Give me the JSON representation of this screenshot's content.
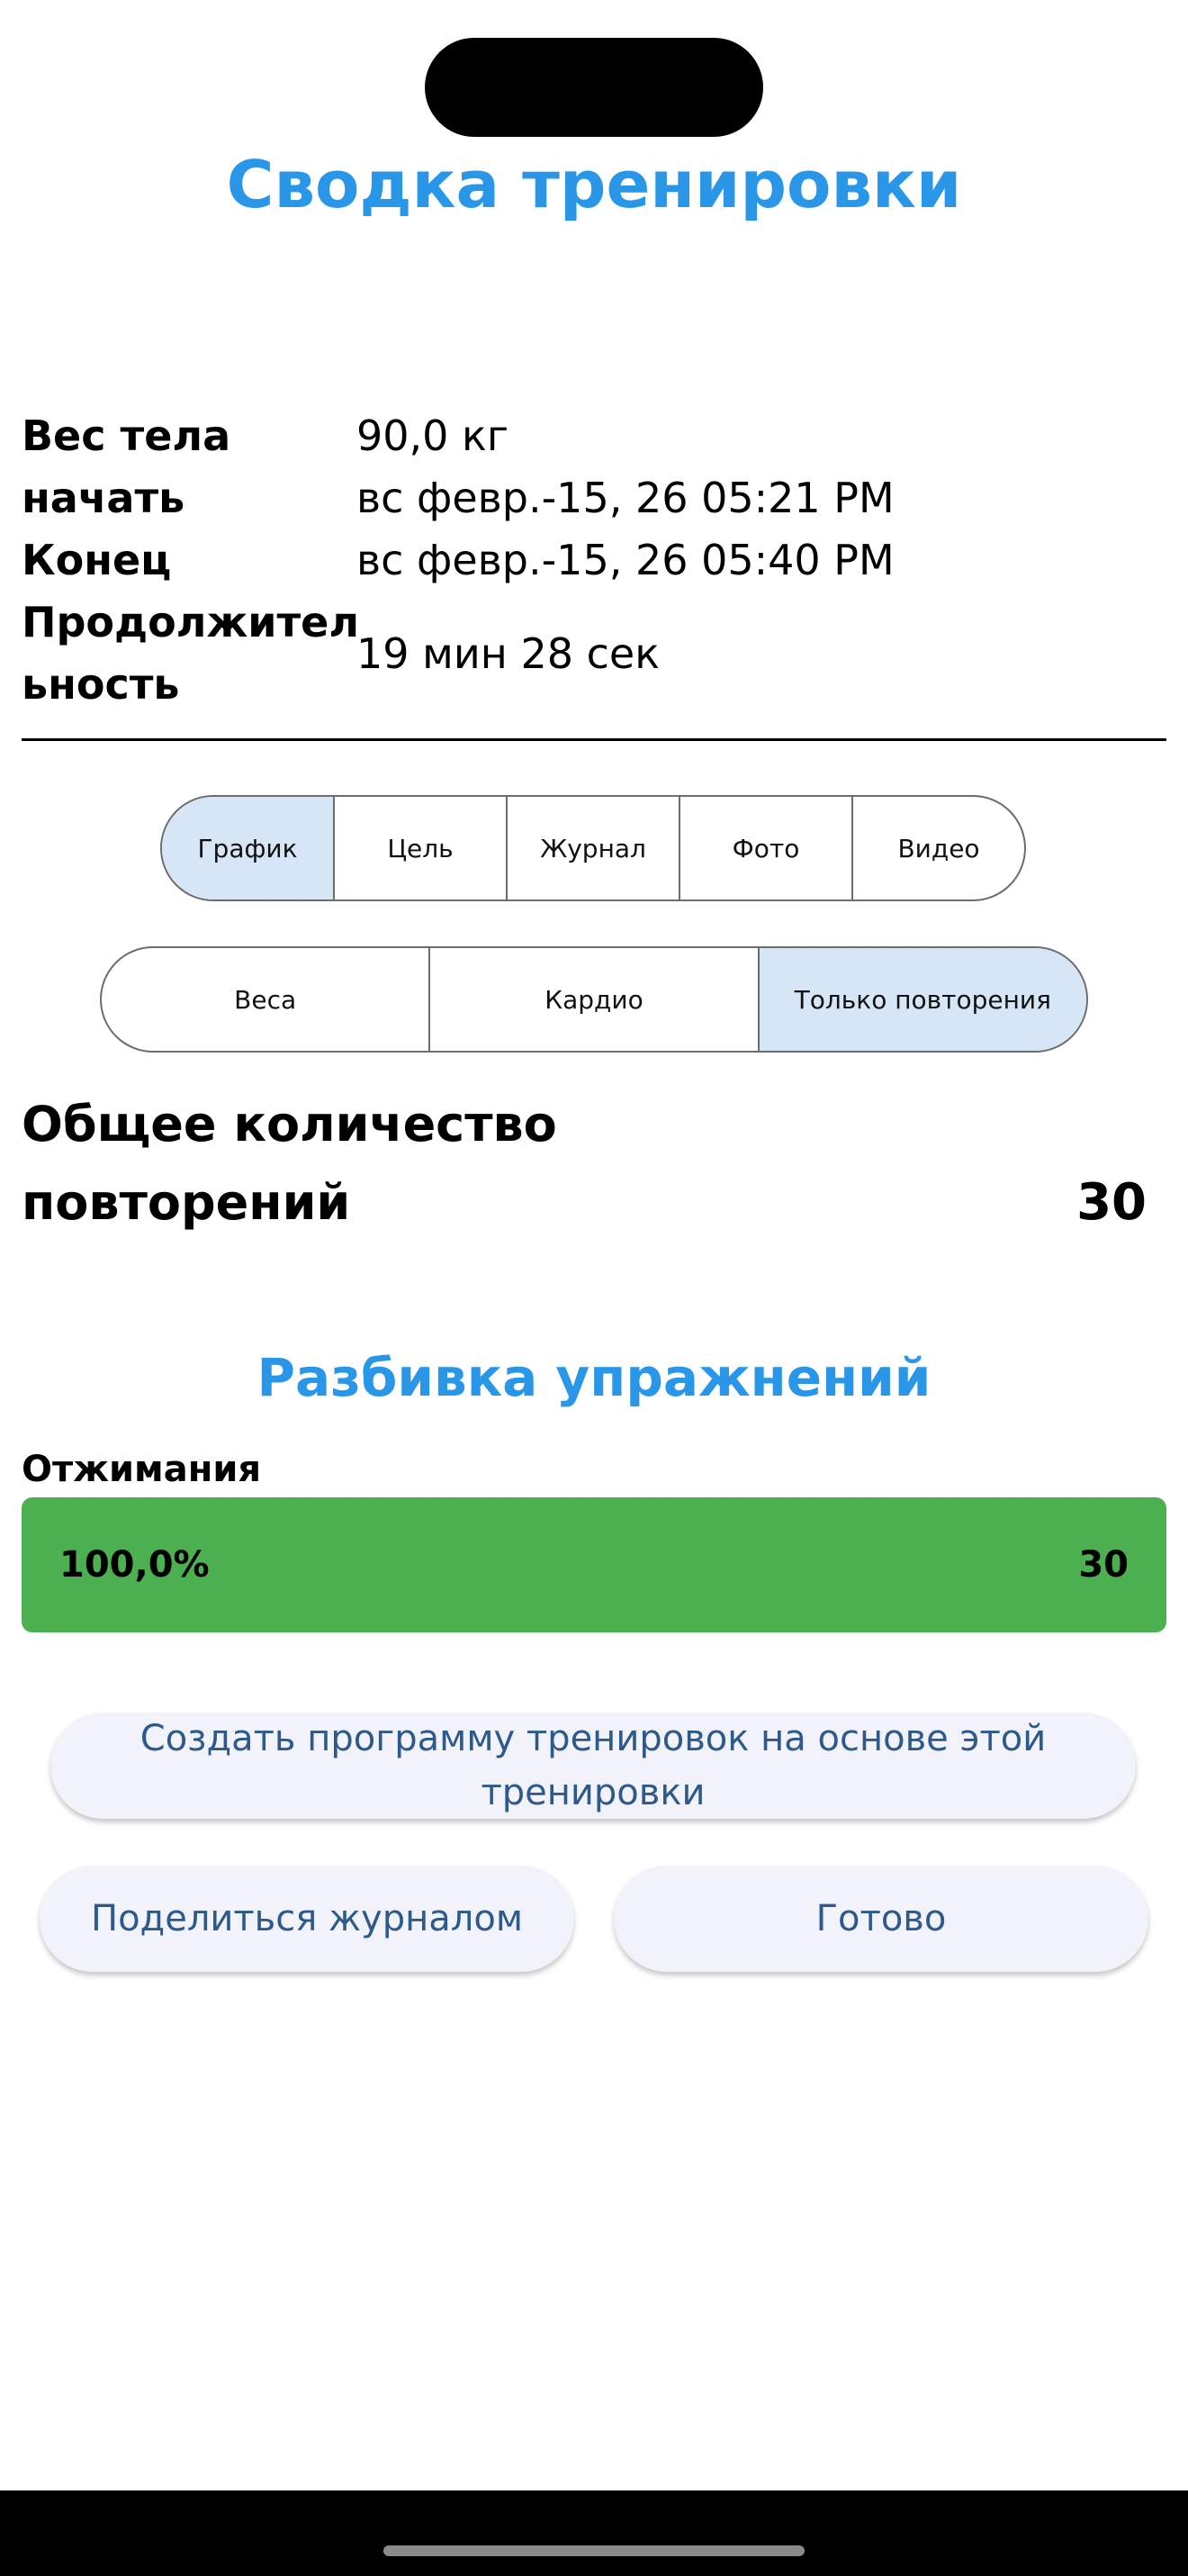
{
  "page": {
    "title": "Сводка тренировки"
  },
  "info": [
    {
      "label": "Вес тела",
      "value": "90,0 кг"
    },
    {
      "label": "начать",
      "value": "вс февр.-15, 26 05:21 PM"
    },
    {
      "label": "Конец",
      "value": "вс февр.-15, 26 05:40 PM"
    },
    {
      "label": "Продолжител ьность",
      "value": "19 мин 28 сек"
    }
  ],
  "tabs": {
    "items": [
      "График",
      "Цель",
      "Журнал",
      "Фото",
      "Видео"
    ],
    "selected": "График"
  },
  "filters": {
    "items": [
      "Веса",
      "Кардио",
      "Только повторения"
    ],
    "selected": "Только повторения"
  },
  "total": {
    "label": "Общее количество повторений",
    "value": "30"
  },
  "breakdown": {
    "title": "Разбивка упражнений",
    "exercises": [
      {
        "name": "Отжимания",
        "percent_label": "100,0%",
        "fraction": 1.0,
        "count": "30"
      }
    ]
  },
  "buttons": {
    "create_program": "Создать программу тренировок на основе этой тренировки",
    "share_log": "Поделиться журналом",
    "done": "Готово"
  },
  "colors": {
    "accent": "#2a96e8",
    "selected_segment": "#d6e6f7",
    "progress": "#4caf50",
    "button_text": "#2d5a8a",
    "button_bg": "#f2f3fa"
  }
}
